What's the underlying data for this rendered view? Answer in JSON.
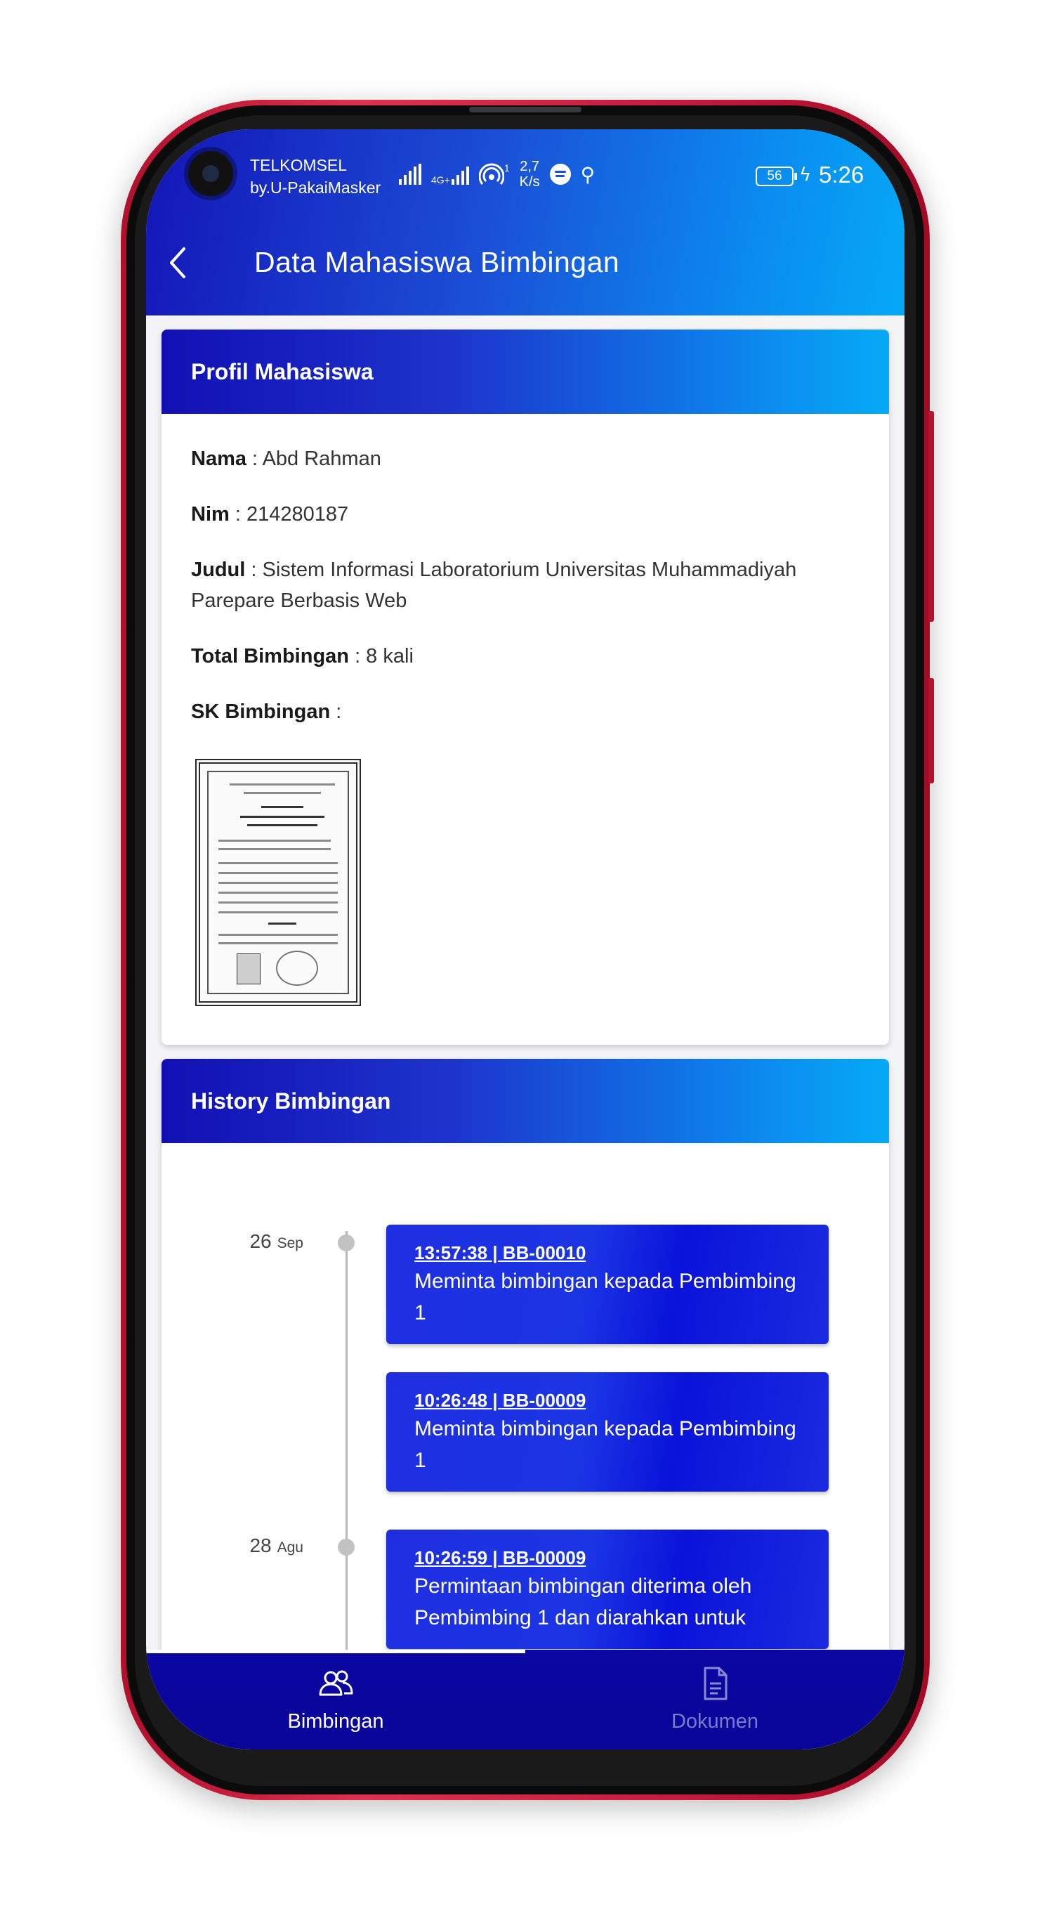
{
  "status_bar": {
    "carrier_line1": "TELKOMSEL",
    "carrier_line2": "by.U-PakaiMasker",
    "net_badge": "4G+",
    "hotspot_count": "1",
    "speed_value": "2,7",
    "speed_unit": "K/s",
    "battery": "56",
    "time": "5:26"
  },
  "header": {
    "title": "Data Mahasiswa Bimbingan",
    "back_icon": "chevron-left-icon"
  },
  "profile": {
    "section_title": "Profil Mahasiswa",
    "name_label": "Nama",
    "name_value": " : Abd Rahman",
    "nim_label": "Nim",
    "nim_value": " : 214280187",
    "judul_label": "Judul",
    "judul_value": " : Sistem Informasi Laboratorium Universitas Muhammadiyah Parepare Berbasis Web",
    "total_label": "Total Bimbingan",
    "total_value": " : 8 kali",
    "sk_label": "SK Bimbingan",
    "sk_value": " :"
  },
  "history": {
    "section_title": "History Bimbingan",
    "groups": [
      {
        "day": "26",
        "month": "Sep",
        "entries": [
          {
            "code": "13:57:38 | BB-00010",
            "text": "Meminta bimbingan kepada Pembimbing 1"
          },
          {
            "code": "10:26:48 | BB-00009",
            "text": "Meminta bimbingan kepada Pembimbing 1"
          }
        ]
      },
      {
        "day": "28",
        "month": "Agu",
        "entries": [
          {
            "code": "10:26:59 | BB-00009",
            "text": "Permintaan bimbingan diterima oleh Pembimbing 1 dan diarahkan untuk"
          }
        ]
      }
    ]
  },
  "bottom_nav": {
    "items": [
      {
        "label": "Bimbingan",
        "icon": "users-icon",
        "active": true
      },
      {
        "label": "Dokumen",
        "icon": "document-icon",
        "active": false
      }
    ]
  },
  "colors": {
    "header_start": "#1416b8",
    "header_end": "#06a9f6",
    "timeline_card": "#1b35e5",
    "bottom_nav": "#0b07a2",
    "phone_frame": "#c71a3a"
  }
}
